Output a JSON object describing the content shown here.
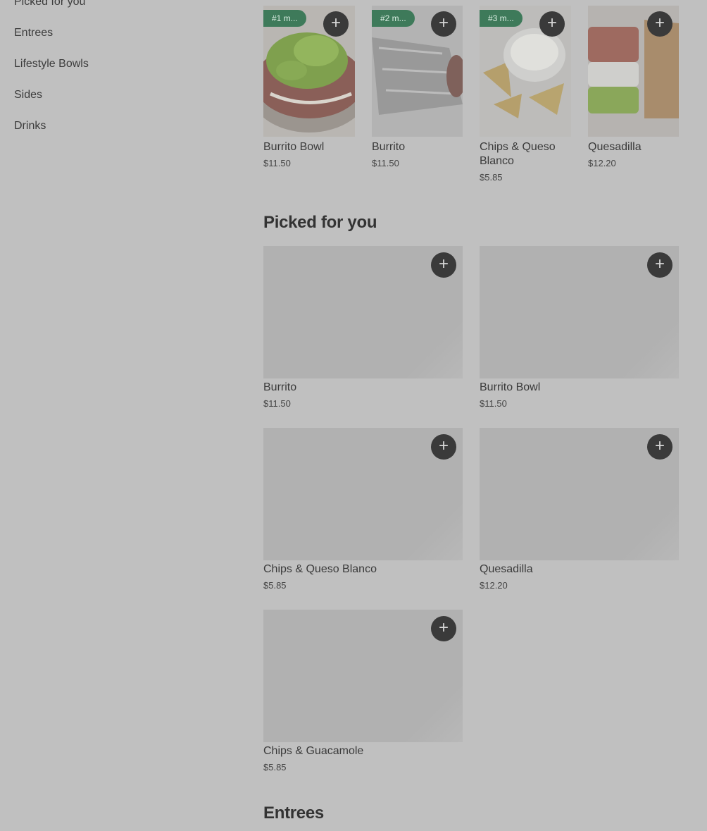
{
  "sidebar": {
    "items": [
      {
        "label": "Picked for you"
      },
      {
        "label": "Entrees"
      },
      {
        "label": "Lifestyle Bowls"
      },
      {
        "label": "Sides"
      },
      {
        "label": "Drinks"
      }
    ]
  },
  "top_items": [
    {
      "badge": "#1 m...",
      "name": "Burrito Bowl",
      "price": "$11.50"
    },
    {
      "badge": "#2 m...",
      "name": "Burrito",
      "price": "$11.50"
    },
    {
      "badge": "#3 m...",
      "name": "Chips & Queso Blanco",
      "price": "$5.85"
    },
    {
      "name": "Quesadilla",
      "price": "$12.20"
    }
  ],
  "picked_section": {
    "title": "Picked for you",
    "items": [
      {
        "name": "Burrito",
        "price": "$11.50"
      },
      {
        "name": "Burrito Bowl",
        "price": "$11.50"
      },
      {
        "name": "Chips & Queso Blanco",
        "price": "$5.85"
      },
      {
        "name": "Quesadilla",
        "price": "$12.20"
      },
      {
        "name": "Chips & Guacamole",
        "price": "$5.85"
      }
    ]
  },
  "entrees_section": {
    "title": "Entrees"
  },
  "add_icon": "plus-icon",
  "colors": {
    "background": "#c0c0c0",
    "badge": "#3e7a5a",
    "add_button": "#3a3a3a"
  }
}
